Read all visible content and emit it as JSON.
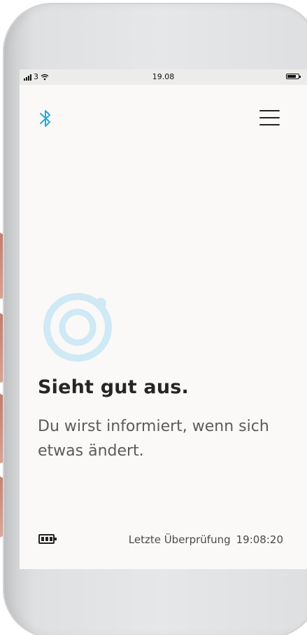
{
  "status_bar": {
    "carrier": "3",
    "time": "19.08",
    "signal_bars": 4,
    "battery_level": 0.8
  },
  "header": {
    "bluetooth_icon": "bluetooth-icon",
    "menu_icon": "hamburger-menu-icon"
  },
  "status": {
    "icon": "ring-status-icon",
    "headline": "Sieht gut aus.",
    "message": "Du wirst informiert, wenn sich etwas ändert."
  },
  "footer": {
    "battery_icon": "battery-icon",
    "last_check_label": "Letzte Überprüfung",
    "last_check_time": "19:08:20"
  },
  "colors": {
    "accent": "#2aa8d8",
    "ring": "#cfe9f5",
    "screen_bg": "#faf9f7",
    "text_dark": "#262626",
    "text_muted": "#5b5b5b"
  }
}
